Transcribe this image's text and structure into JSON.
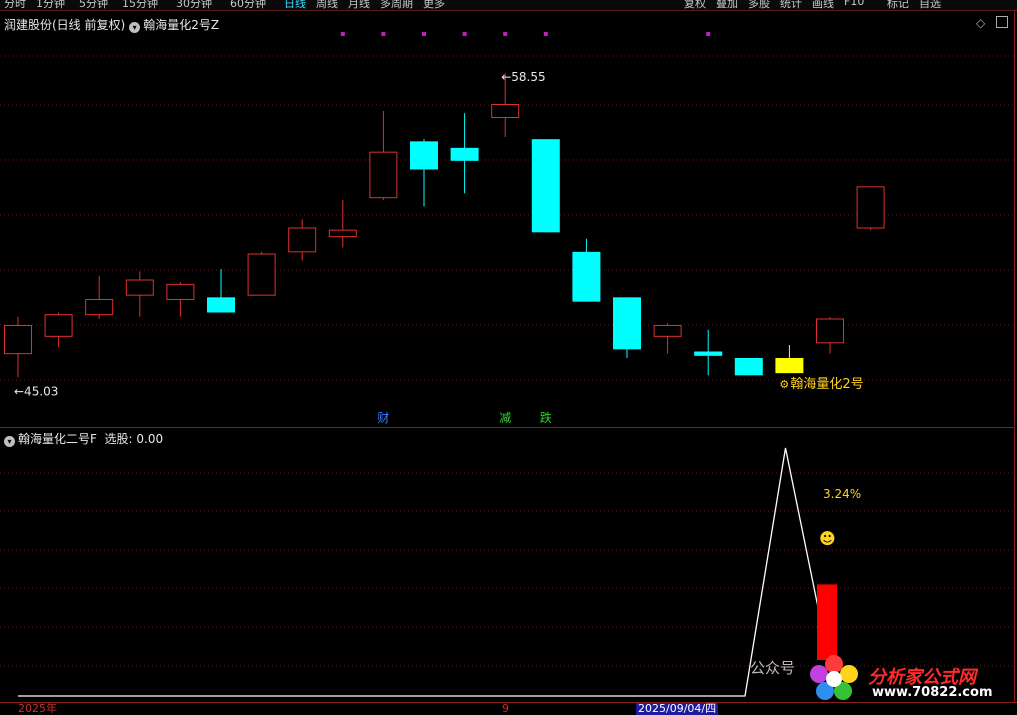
{
  "top_tabs": [
    "分时",
    "1分钟",
    "5分钟",
    "15分钟",
    "30分钟",
    "60分钟",
    "日线",
    "周线",
    "月线",
    "多周期",
    "更多",
    "复权",
    "叠加",
    "多股",
    "统计",
    "画线",
    "F10",
    "标记",
    "自选"
  ],
  "active_tab": "日线",
  "main_title": {
    "stock": "润建股份(日线 前复权)",
    "indicator": "翰海量化2号Z"
  },
  "indicator_title": {
    "name": "翰海量化二号F",
    "value_label": "选股: 0.00"
  },
  "main_labels": {
    "high": "58.55",
    "low": "45.03",
    "arrow": "←",
    "signal": "翰海量化2号",
    "signal_icon": "⚙"
  },
  "event_markers": [
    "财",
    "减",
    "跌"
  ],
  "indicator_labels": {
    "pct": "3.24%",
    "smiley": "☻"
  },
  "bottom_axis": {
    "year": "2025年",
    "month": "9",
    "cursor_date": "2025/09/04/四"
  },
  "watermark": {
    "gzh": "公众号",
    "logo_text": "分析家公式网",
    "logo_url": "www.70822.com"
  },
  "colors": {
    "up": "#e03030",
    "down": "#00ffff",
    "highlight": "#ffff00",
    "dots": "#c020c0",
    "indicator_line": "#ffffff",
    "bar": "#ff0000",
    "text_yellow": "#ffd21e"
  },
  "chart_data": {
    "type": "candlestick",
    "y_range": [
      43,
      61
    ],
    "candles": [
      {
        "o": 45.6,
        "h": 47.3,
        "l": 44.5,
        "c": 46.9
      },
      {
        "o": 46.4,
        "h": 47.5,
        "l": 45.9,
        "c": 47.4
      },
      {
        "o": 47.4,
        "h": 49.2,
        "l": 47.2,
        "c": 48.1
      },
      {
        "o": 48.3,
        "h": 49.4,
        "l": 47.3,
        "c": 49.0
      },
      {
        "o": 48.1,
        "h": 48.9,
        "l": 47.3,
        "c": 48.8
      },
      {
        "o": 48.2,
        "h": 49.5,
        "l": 47.9,
        "c": 47.5
      },
      {
        "o": 48.3,
        "h": 50.3,
        "l": 48.3,
        "c": 50.2
      },
      {
        "o": 50.3,
        "h": 51.8,
        "l": 49.9,
        "c": 51.4
      },
      {
        "o": 51.0,
        "h": 52.7,
        "l": 50.5,
        "c": 51.3
      },
      {
        "o": 52.8,
        "h": 56.8,
        "l": 52.7,
        "c": 54.9
      },
      {
        "o": 55.4,
        "h": 55.5,
        "l": 52.4,
        "c": 54.1
      },
      {
        "o": 55.1,
        "h": 56.7,
        "l": 53.0,
        "c": 54.5
      },
      {
        "o": 56.5,
        "h": 58.55,
        "l": 55.6,
        "c": 57.1
      },
      {
        "o": 55.5,
        "h": 55.5,
        "l": 51.2,
        "c": 51.2
      },
      {
        "o": 50.3,
        "h": 50.9,
        "l": 48.0,
        "c": 48.0
      },
      {
        "o": 48.2,
        "h": 48.2,
        "l": 45.4,
        "c": 45.8
      },
      {
        "o": 46.4,
        "h": 47.0,
        "l": 45.6,
        "c": 46.9
      },
      {
        "o": 45.7,
        "h": 46.7,
        "l": 44.6,
        "c": 45.5
      },
      {
        "o": 45.4,
        "h": 45.4,
        "l": 44.6,
        "c": 44.6
      },
      {
        "o": 45.4,
        "h": 46.0,
        "l": 44.7,
        "c": 44.7
      },
      {
        "o": 46.1,
        "h": 47.3,
        "l": 45.6,
        "c": 47.2
      },
      {
        "o": 51.4,
        "h": 51.4,
        "l": 51.3,
        "c": 53.3
      }
    ],
    "highlight_index": 19,
    "dot_indices": [
      8,
      9,
      10,
      11,
      12,
      13,
      17
    ],
    "indicator": {
      "line": [
        0,
        0,
        0,
        0,
        0,
        0,
        0,
        0,
        0,
        0,
        0,
        0,
        0,
        0,
        0,
        0,
        0,
        0,
        0,
        100,
        20,
        20
      ],
      "bar_index": 20,
      "bar_value": 45
    }
  }
}
